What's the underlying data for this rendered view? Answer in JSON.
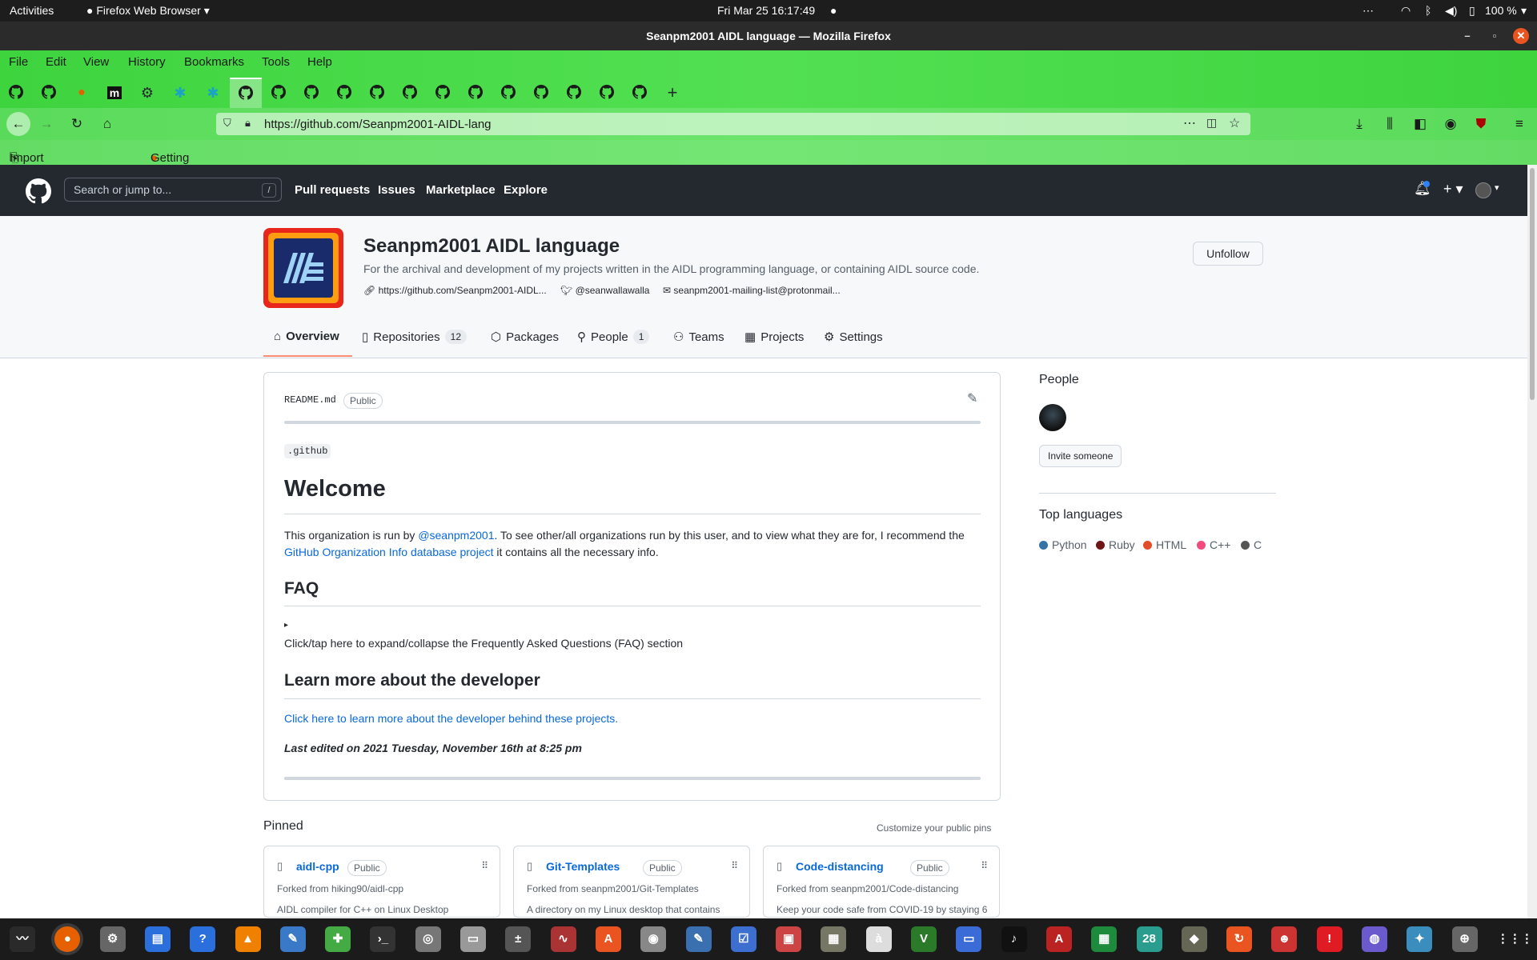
{
  "system": {
    "activities": "Activities",
    "app": "Firefox Web Browser",
    "clock": "Fri Mar 25  16:17:49",
    "battery": "100 %"
  },
  "window": {
    "title": "Seanpm2001 AIDL language — Mozilla Firefox"
  },
  "menu": [
    "File",
    "Edit",
    "View",
    "History",
    "Bookmarks",
    "Tools",
    "Help"
  ],
  "browser": {
    "url": "https://github.com/Seanpm2001-AIDL-lang",
    "bookmarks": [
      "Import bookmarks...",
      "Getting Started"
    ]
  },
  "gh": {
    "search_placeholder": "Search or jump to...",
    "slash": "/",
    "nav": [
      "Pull requests",
      "Issues",
      "Marketplace",
      "Explore"
    ]
  },
  "org": {
    "name": "Seanpm2001 AIDL language",
    "description": "For the archival and development of my projects written in the AIDL programming language, or containing AIDL source code.",
    "link": "https://github.com/Seanpm2001-AIDL...",
    "twitter": "@seanwallawalla",
    "email": "seanpm2001-mailing-list@protonmail...",
    "unfollow": "Unfollow",
    "tabs": [
      {
        "label": "Overview"
      },
      {
        "label": "Repositories",
        "count": "12"
      },
      {
        "label": "Packages"
      },
      {
        "label": "People",
        "count": "1"
      },
      {
        "label": "Teams"
      },
      {
        "label": "Projects"
      },
      {
        "label": "Settings"
      }
    ]
  },
  "readme": {
    "file": "README.md",
    "badge": "Public",
    "code": ".github",
    "h1": "Welcome",
    "p1a": "This organization is run by ",
    "p1link": "@seanpm2001",
    "p1b": ". To see other/all organizations run by this user, and to view what they are for, I recommend the",
    "p2link": "GitHub Organization Info database project",
    "p2b": " it contains all the necessary info.",
    "h2a": "FAQ",
    "faq_marker": "▸",
    "faq": "Click/tap here to expand/collapse the Frequently Asked Questions (FAQ) section",
    "h2b": "Learn more about the developer",
    "devlink": "Click here to learn more about the developer behind these projects.",
    "edited": "Last edited on 2021 Tuesday, November 16th at 8:25 pm"
  },
  "sidebar": {
    "people": "People",
    "invite": "Invite someone",
    "top_lang": "Top languages",
    "languages": [
      {
        "name": "Python",
        "color": "#3572A5"
      },
      {
        "name": "Ruby",
        "color": "#701516"
      },
      {
        "name": "HTML",
        "color": "#e34c26"
      },
      {
        "name": "C++",
        "color": "#f34b7d"
      },
      {
        "name": "C",
        "color": "#555555"
      }
    ]
  },
  "pinned": {
    "title": "Pinned",
    "customize": "Customize your public pins",
    "cards": [
      {
        "name": "aidl-cpp",
        "badge": "Public",
        "forked": "Forked from hiking90/aidl-cpp",
        "desc": "AIDL compiler for C++ on Linux Desktop"
      },
      {
        "name": "Git-Templates",
        "badge": "Public",
        "forked": "Forked from seanpm2001/Git-Templates",
        "desc": "A directory on my Linux desktop that contains"
      },
      {
        "name": "Code-distancing",
        "badge": "Public",
        "forked": "Forked from seanpm2001/Code-distancing",
        "desc": "Keep your code safe from COVID-19 by staying 6"
      }
    ]
  },
  "dock": {
    "calendar_day": "28"
  }
}
